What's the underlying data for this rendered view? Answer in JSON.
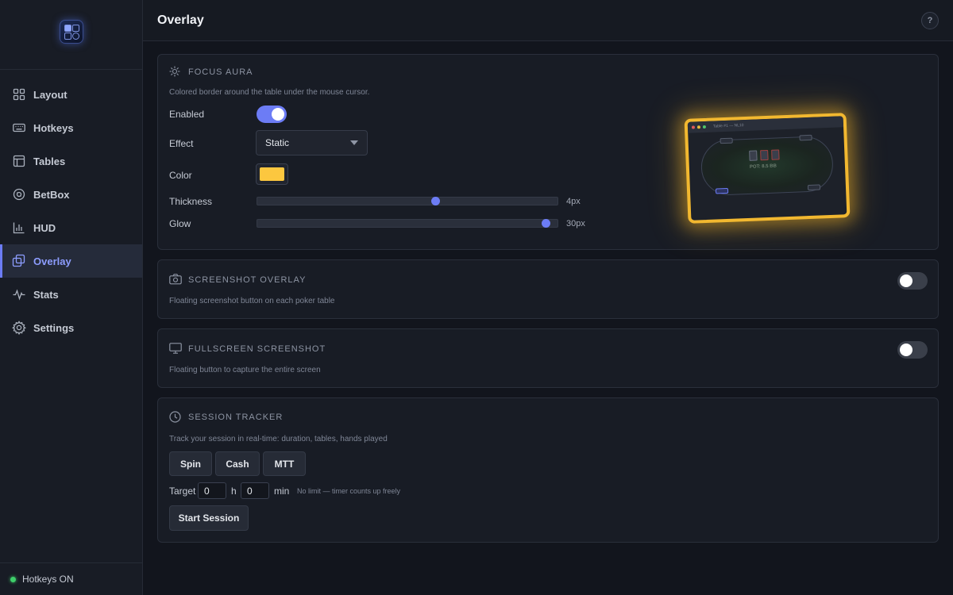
{
  "sidebar": {
    "logo": "app-logo",
    "items": [
      {
        "label": "Layout",
        "icon": "grid-icon"
      },
      {
        "label": "Hotkeys",
        "icon": "keyboard-icon"
      },
      {
        "label": "Tables",
        "icon": "table-icon"
      },
      {
        "label": "BetBox",
        "icon": "chip-icon"
      },
      {
        "label": "HUD",
        "icon": "bar-chart-icon"
      },
      {
        "label": "Overlay",
        "icon": "layers-icon",
        "active": true
      },
      {
        "label": "Stats",
        "icon": "activity-icon"
      },
      {
        "label": "Settings",
        "icon": "gear-icon"
      }
    ],
    "footer_status": "Hotkeys ON",
    "footer_status_color": "#3ecf6a"
  },
  "header": {
    "title": "Overlay",
    "help_label": "?"
  },
  "focus_aura": {
    "title": "FOCUS AURA",
    "description": "Colored border around the table under the mouse cursor.",
    "enabled_label": "Enabled",
    "enabled": true,
    "effect_label": "Effect",
    "effect_value": "Static",
    "color_label": "Color",
    "color_value": "#fcc73f",
    "thickness_label": "Thickness",
    "thickness_value": "4px",
    "glow_label": "Glow",
    "glow_value": "30px",
    "preview": {
      "table_title": "Table #1 — NL10",
      "pot_text": "POT: 8.5 BB"
    }
  },
  "screenshot_overlay": {
    "title": "SCREENSHOT OVERLAY",
    "description": "Floating screenshot button on each poker table",
    "enabled": false
  },
  "fullscreen_screenshot": {
    "title": "FULLSCREEN SCREENSHOT",
    "description": "Floating button to capture the entire screen",
    "enabled": false
  },
  "session_tracker": {
    "title": "SESSION TRACKER",
    "description": "Track your session in real-time: duration, tables, hands played",
    "modes": [
      "Spin",
      "Cash",
      "MTT"
    ],
    "target_label": "Target",
    "hours_value": "0",
    "hours_unit": "h",
    "minutes_value": "0",
    "minutes_unit": "min",
    "hint": "No limit — timer counts up freely",
    "start_label": "Start Session"
  },
  "colors": {
    "accent": "#6c7cf5",
    "aura": "#f2b830"
  }
}
